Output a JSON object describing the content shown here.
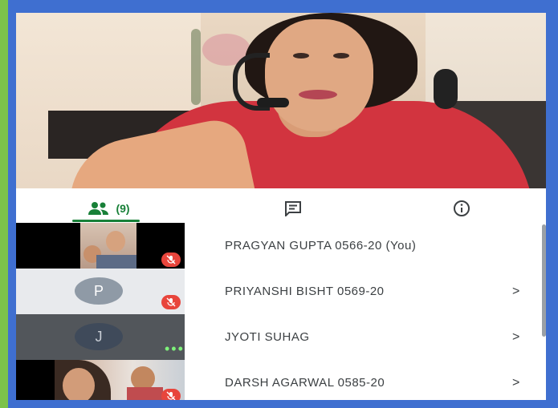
{
  "tabs": [
    {
      "name": "people-tab",
      "count": "(9)",
      "icon": "people-icon"
    },
    {
      "name": "chat-tab",
      "icon": "chat-icon"
    },
    {
      "name": "info-tab",
      "icon": "info-icon"
    }
  ],
  "participants": [
    {
      "name": "PRAGYAN GUPTA 0566-20 (You)",
      "chevron": "",
      "avatar": "",
      "muted": true
    },
    {
      "name": "PRIYANSHI BISHT 0569-20",
      "chevron": ">",
      "avatar": "P",
      "muted": true
    },
    {
      "name": "JYOTI SUHAG",
      "chevron": ">",
      "avatar": "J",
      "muted": false
    },
    {
      "name": "DARSH AGARWAL 0585-20",
      "chevron": ">",
      "avatar": "",
      "muted": true
    }
  ],
  "colors": {
    "accent": "#188038",
    "mute": "#e8453c",
    "avatar_p": "#8f9aa6",
    "avatar_j": "#3f4a5a"
  }
}
